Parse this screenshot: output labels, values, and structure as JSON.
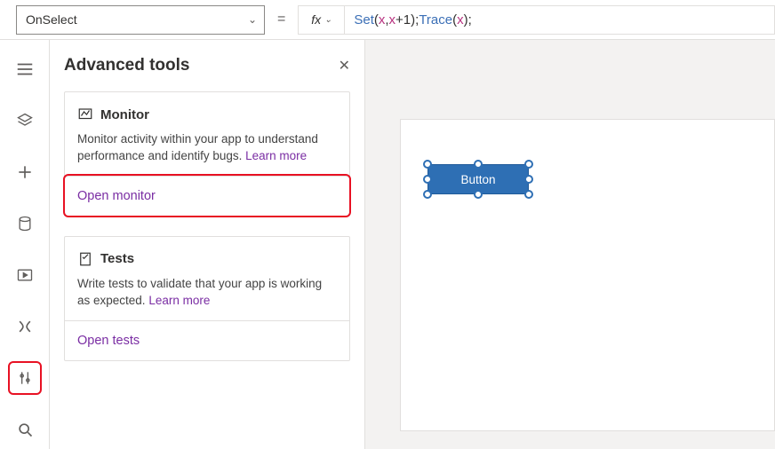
{
  "formula_bar": {
    "property": "OnSelect",
    "fx_label": "fx",
    "formula_tokens": [
      {
        "t": "fn",
        "v": "Set"
      },
      {
        "t": "punc",
        "v": "( "
      },
      {
        "t": "id",
        "v": "x"
      },
      {
        "t": "punc",
        "v": ", "
      },
      {
        "t": "id",
        "v": "x"
      },
      {
        "t": "punc",
        "v": "+"
      },
      {
        "t": "punc",
        "v": "1 "
      },
      {
        "t": "punc",
        "v": "); "
      },
      {
        "t": "fn",
        "v": "Trace"
      },
      {
        "t": "punc",
        "v": "( "
      },
      {
        "t": "id",
        "v": "x"
      },
      {
        "t": "punc",
        "v": " );"
      }
    ]
  },
  "panel": {
    "title": "Advanced tools",
    "monitor": {
      "heading": "Monitor",
      "desc": "Monitor activity within your app to understand performance and identify bugs. ",
      "learn": "Learn more",
      "action": "Open monitor"
    },
    "tests": {
      "heading": "Tests",
      "desc": "Write tests to validate that your app is working as expected. ",
      "learn": "Learn more",
      "action": "Open tests"
    }
  },
  "canvas": {
    "button_label": "Button"
  },
  "rail": {
    "items": [
      "hamburger",
      "layers",
      "insert",
      "data",
      "media",
      "variables",
      "tools",
      "search"
    ]
  }
}
